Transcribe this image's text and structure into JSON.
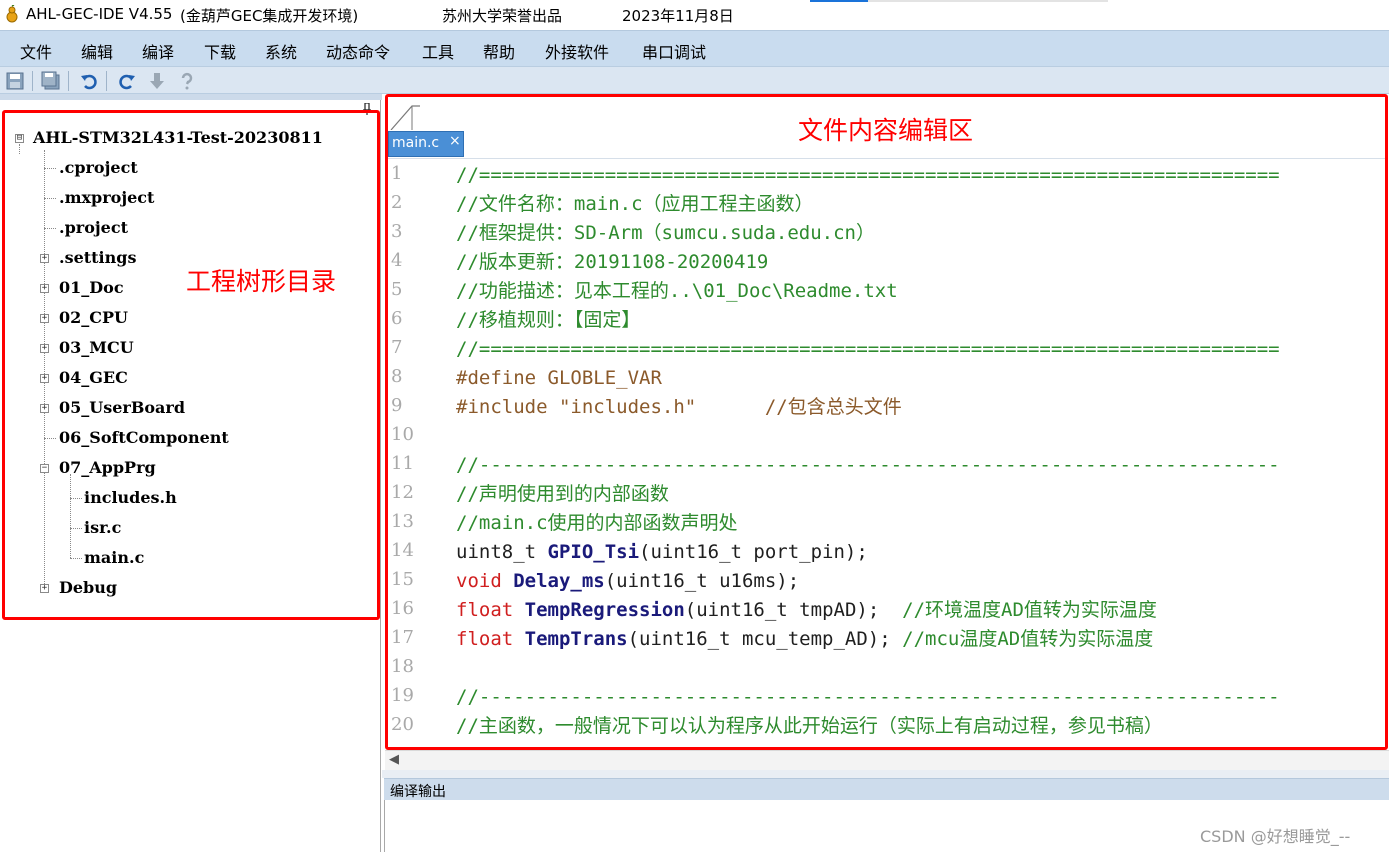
{
  "titlebar": {
    "app_name": "AHL-GEC-IDE V4.55",
    "subtitle": "(金葫芦GEC集成开发环境)",
    "org": "苏州大学荣誉出品",
    "date": "2023年11月8日"
  },
  "menu": [
    "文件",
    "编辑",
    "编译",
    "下载",
    "系统",
    "动态命令",
    "工具",
    "帮助",
    "外接软件",
    "串口调试"
  ],
  "toolbar": {
    "icons": [
      "save-icon",
      "save-all-icon",
      "undo-icon",
      "redo-icon",
      "download-arrow-icon",
      "help-icon"
    ]
  },
  "tree": {
    "items": [
      {
        "label": "AHL-STM32L431-Test-20230811",
        "expander": "⊟"
      },
      {
        "label": ".cproject",
        "expander": ""
      },
      {
        "label": ".mxproject",
        "expander": ""
      },
      {
        "label": ".project",
        "expander": ""
      },
      {
        "label": ".settings",
        "expander": "+"
      },
      {
        "label": "01_Doc",
        "expander": "+"
      },
      {
        "label": "02_CPU",
        "expander": "+"
      },
      {
        "label": "03_MCU",
        "expander": "+"
      },
      {
        "label": "04_GEC",
        "expander": "+"
      },
      {
        "label": "05_UserBoard",
        "expander": "+"
      },
      {
        "label": "06_SoftComponent",
        "expander": ""
      },
      {
        "label": "07_AppPrg",
        "expander": "−"
      },
      {
        "label": "includes.h",
        "expander": ""
      },
      {
        "label": "isr.c",
        "expander": ""
      },
      {
        "label": "main.c",
        "expander": ""
      },
      {
        "label": "Debug",
        "expander": "+"
      }
    ],
    "annotation": "工程树形目录"
  },
  "editor": {
    "annotation": "文件内容编辑区",
    "tab_label": "main.c",
    "tab_close": "×",
    "line_numbers": [
      "1",
      "2",
      "3",
      "4",
      "5",
      "6",
      "7",
      "8",
      "9",
      "10",
      "11",
      "12",
      "13",
      "14",
      "15",
      "16",
      "17",
      "18",
      "19",
      "20"
    ],
    "lines": [
      [
        {
          "c": "comment",
          "t": "//======================================================================"
        }
      ],
      [
        {
          "c": "comment",
          "t": "//文件名称：main.c（应用工程主函数）"
        }
      ],
      [
        {
          "c": "comment",
          "t": "//框架提供：SD-Arm（sumcu.suda.edu.cn）"
        }
      ],
      [
        {
          "c": "comment",
          "t": "//版本更新：20191108-20200419"
        }
      ],
      [
        {
          "c": "comment",
          "t": "//功能描述：见本工程的..\\01_Doc\\Readme.txt"
        }
      ],
      [
        {
          "c": "comment",
          "t": "//移植规则：【固定】"
        }
      ],
      [
        {
          "c": "comment",
          "t": "//======================================================================"
        }
      ],
      [
        {
          "c": "prep",
          "t": "#define GLOBLE_VAR"
        }
      ],
      [
        {
          "c": "prep",
          "t": "#include \"includes.h\"      "
        },
        {
          "c": "str",
          "t": "//包含总头文件"
        }
      ],
      [],
      [
        {
          "c": "comment",
          "t": "//----------------------------------------------------------------------"
        }
      ],
      [
        {
          "c": "comment",
          "t": "//声明使用到的内部函数"
        }
      ],
      [
        {
          "c": "comment",
          "t": "//main.c使用的内部函数声明处"
        }
      ],
      [
        {
          "c": "type",
          "t": "uint8_t "
        },
        {
          "c": "func",
          "t": "GPIO_Tsi"
        },
        {
          "c": "plain",
          "t": "(uint16_t port_pin);"
        }
      ],
      [
        {
          "c": "kw",
          "t": "void "
        },
        {
          "c": "func",
          "t": "Delay_ms"
        },
        {
          "c": "plain",
          "t": "(uint16_t u16ms);"
        }
      ],
      [
        {
          "c": "kw",
          "t": "float "
        },
        {
          "c": "func",
          "t": "TempRegression"
        },
        {
          "c": "plain",
          "t": "(uint16_t tmpAD);  "
        },
        {
          "c": "comment",
          "t": "//环境温度AD值转为实际温度"
        }
      ],
      [
        {
          "c": "kw",
          "t": "float "
        },
        {
          "c": "func",
          "t": "TempTrans"
        },
        {
          "c": "plain",
          "t": "(uint16_t mcu_temp_AD); "
        },
        {
          "c": "comment",
          "t": "//mcu温度AD值转为实际温度"
        }
      ],
      [],
      [
        {
          "c": "comment",
          "t": "//----------------------------------------------------------------------"
        }
      ],
      [
        {
          "c": "comment",
          "t": "//主函数，一般情况下可以认为程序从此开始运行（实际上有启动过程，参见书稿）"
        }
      ]
    ]
  },
  "output": {
    "title": "编译输出"
  },
  "watermark": "CSDN @好想睡觉_--",
  "colors": {
    "annotation_red": "#ff0000",
    "menubar": "#c9dcef",
    "tab_active": "#4a8fd6",
    "comment_green": "#2e8b2e",
    "keyword_red": "#d01f1f",
    "preprocessor_brown": "#8b5a2b",
    "function_navy": "#1a1a7a"
  }
}
